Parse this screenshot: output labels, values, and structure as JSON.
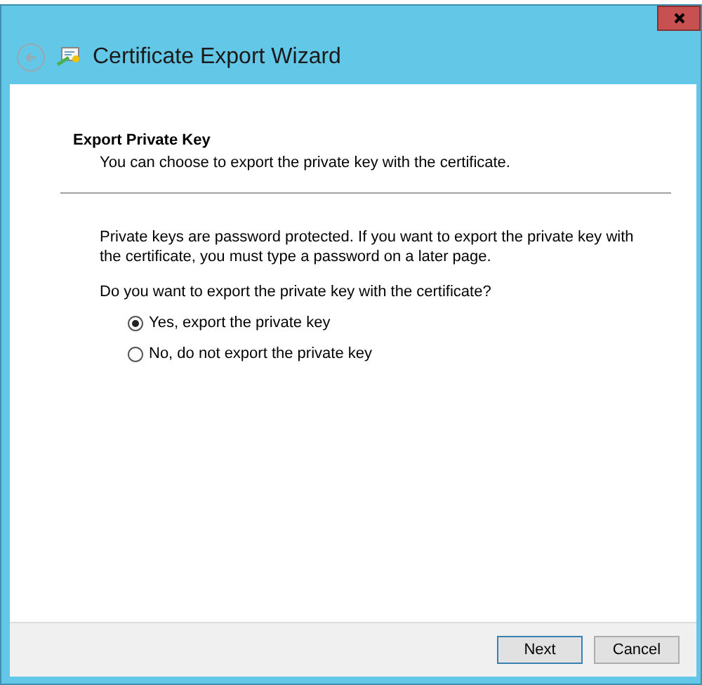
{
  "window": {
    "title": "Certificate Export Wizard"
  },
  "page": {
    "heading": "Export Private Key",
    "subheading": "You can choose to export the private key with the certificate."
  },
  "body": {
    "paragraph": "Private keys are password protected. If you want to export the private key with the certificate, you must type a password on a later page.",
    "question": "Do you want to export the private key with the certificate?",
    "options": [
      {
        "label": "Yes, export the private key",
        "selected": true
      },
      {
        "label": "No, do not export the private key",
        "selected": false
      }
    ]
  },
  "buttons": [
    {
      "label": "Next",
      "default": true
    },
    {
      "label": "Cancel",
      "default": false
    }
  ]
}
